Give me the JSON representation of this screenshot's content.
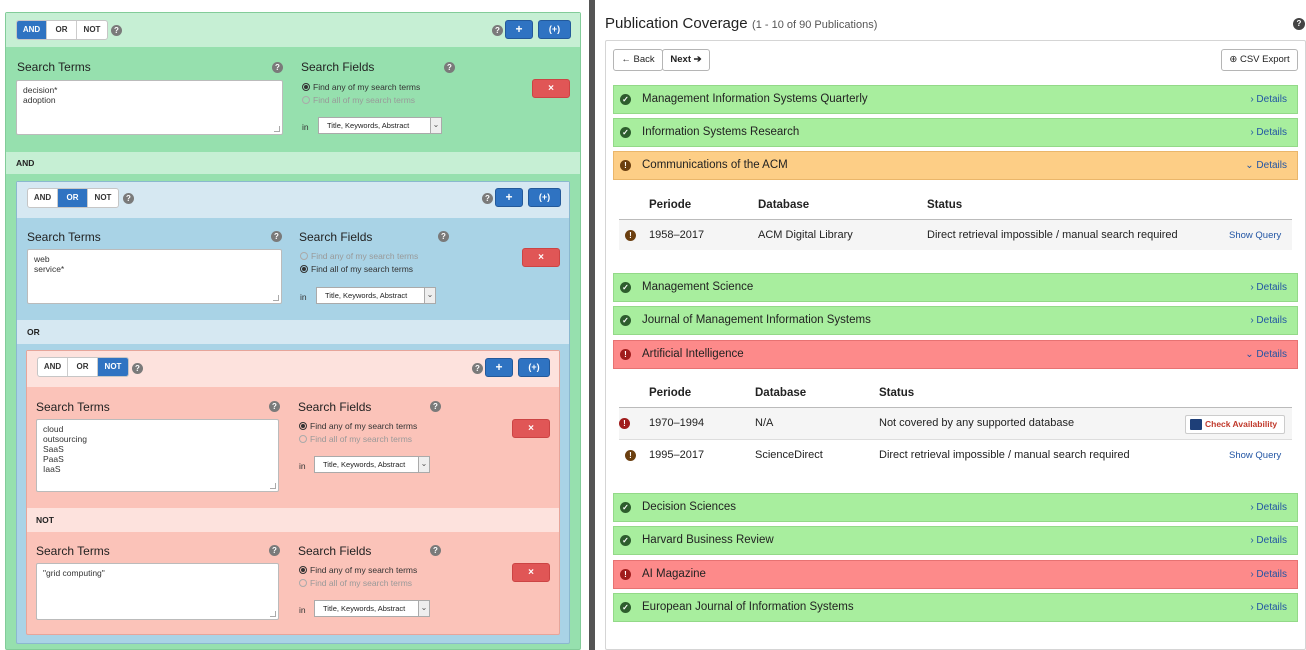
{
  "query_builder": {
    "and_label": "AND",
    "or_label": "OR",
    "not_label": "NOT",
    "help": "?",
    "add_label": "+",
    "group_label": "(+)",
    "remove_label": "×",
    "search_terms_label": "Search Terms",
    "search_fields_label": "Search Fields",
    "find_any": "Find any of my search terms",
    "find_all": "Find all of my search terms",
    "in_label": "in",
    "field_option": "Title, Keywords, Abstract",
    "root_terms": "decision*\nadoption",
    "root_operator_label": "AND",
    "group1_terms": "web\nservice*",
    "group1_operator_label": "OR",
    "group2_terms1": "cloud\noutsourcing\nSaaS\nPaaS\nIaaS",
    "group2_operator_label": "NOT",
    "group2_terms2": "\"grid computing\""
  },
  "coverage": {
    "title": "Publication Coverage",
    "subtitle": "(1 - 10 of 90 Publications)",
    "back": "← Back",
    "next": "Next ➔",
    "csv": "⊕ CSV Export",
    "details": "› Details",
    "details_open": "⌄ Details",
    "col_periode": "Periode",
    "col_database": "Database",
    "col_status": "Status",
    "show_query": "Show Query",
    "check_availability": "Check Availability",
    "publications": [
      {
        "name": "Management Information Systems Quarterly",
        "status": "green"
      },
      {
        "name": "Information Systems Research",
        "status": "green"
      },
      {
        "name": "Communications of the ACM",
        "status": "orange"
      },
      {
        "name": "Management Science",
        "status": "green"
      },
      {
        "name": "Journal of Management Information Systems",
        "status": "green"
      },
      {
        "name": "Artificial Intelligence",
        "status": "red"
      },
      {
        "name": "Decision Sciences",
        "status": "green"
      },
      {
        "name": "Harvard Business Review",
        "status": "green"
      },
      {
        "name": "AI Magazine",
        "status": "red"
      },
      {
        "name": "European Journal of Information Systems",
        "status": "green"
      }
    ],
    "acm_rows": [
      {
        "periode": "1958–2017",
        "database": "ACM Digital Library",
        "status": "Direct retrieval impossible / manual search required"
      }
    ],
    "ai_rows": [
      {
        "periode": "1970–1994",
        "database": "N/A",
        "status": "Not covered by any supported database"
      },
      {
        "periode": "1995–2017",
        "database": "ScienceDirect",
        "status": "Direct retrieval impossible / manual search required"
      }
    ]
  },
  "colors": {
    "green_bg": "#a8ee9e",
    "orange_bg": "#fdce86",
    "red_bg": "#fd8a8a",
    "primary": "#2f73c2",
    "danger": "#e05656"
  }
}
